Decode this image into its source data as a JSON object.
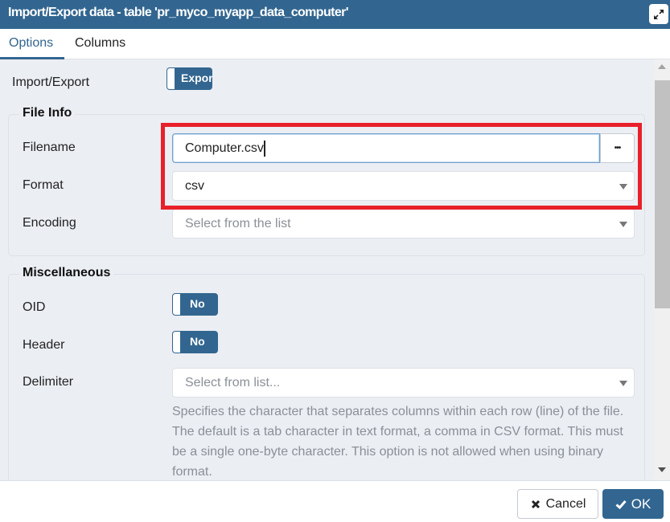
{
  "dialog": {
    "title": "Import/Export data - table 'pr_myco_myapp_data_computer'",
    "maximize_icon": "expand-icon"
  },
  "tabs": [
    {
      "label": "Options",
      "active": true
    },
    {
      "label": "Columns",
      "active": false
    }
  ],
  "import_export": {
    "label": "Import/Export",
    "toggle_text": "Expor"
  },
  "file_info": {
    "legend": "File Info",
    "filename": {
      "label": "Filename",
      "value": "Computer.csv",
      "browse_label": "•••"
    },
    "format": {
      "label": "Format",
      "value": "csv"
    },
    "encoding": {
      "label": "Encoding",
      "placeholder": "Select from the list"
    }
  },
  "miscellaneous": {
    "legend": "Miscellaneous",
    "oid": {
      "label": "OID",
      "toggle_text": "No"
    },
    "header": {
      "label": "Header",
      "toggle_text": "No"
    },
    "delimiter": {
      "label": "Delimiter",
      "placeholder": "Select from list...",
      "help": "Specifies the character that separates columns within each row (line) of the file. The default is a tab character in text format, a comma in CSV format. This must be a single one-byte character. This option is not allowed when using binary format."
    }
  },
  "footer": {
    "cancel_label": "Cancel",
    "ok_label": "OK"
  },
  "colors": {
    "primary": "#326690",
    "highlight": "#e8202a",
    "background": "#ebeef3"
  }
}
